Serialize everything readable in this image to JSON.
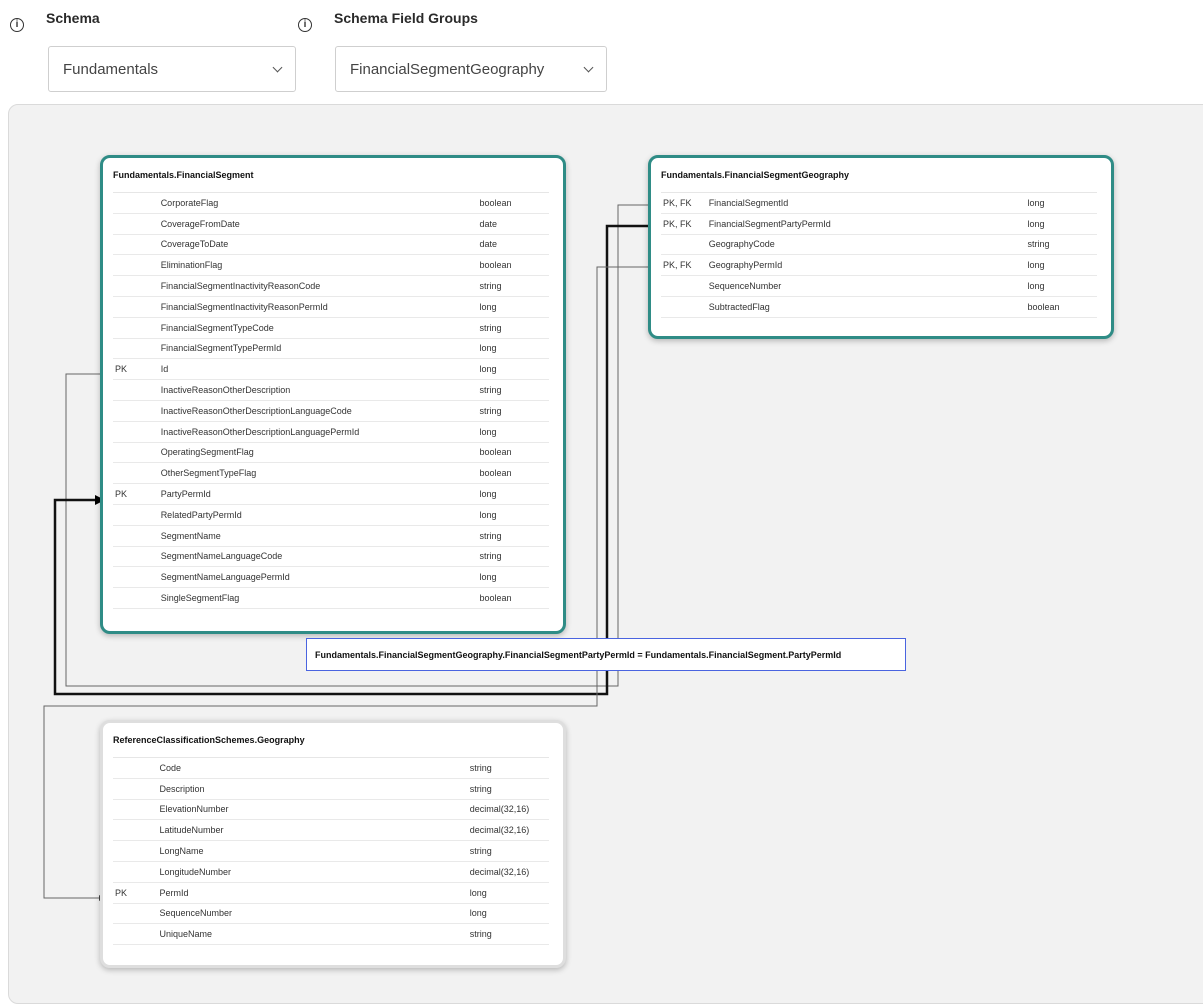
{
  "schema": {
    "label": "Schema",
    "value": "Fundamentals"
  },
  "field_groups": {
    "label": "Schema Field Groups",
    "value": "FinancialSegmentGeography"
  },
  "tables": [
    {
      "title": "Fundamentals.FinancialSegment",
      "rows": [
        {
          "key": "",
          "name": "CorporateFlag",
          "type": "boolean"
        },
        {
          "key": "",
          "name": "CoverageFromDate",
          "type": "date"
        },
        {
          "key": "",
          "name": "CoverageToDate",
          "type": "date"
        },
        {
          "key": "",
          "name": "EliminationFlag",
          "type": "boolean"
        },
        {
          "key": "",
          "name": "FinancialSegmentInactivityReasonCode",
          "type": "string"
        },
        {
          "key": "",
          "name": "FinancialSegmentInactivityReasonPermId",
          "type": "long"
        },
        {
          "key": "",
          "name": "FinancialSegmentTypeCode",
          "type": "string"
        },
        {
          "key": "",
          "name": "FinancialSegmentTypePermId",
          "type": "long"
        },
        {
          "key": "PK",
          "name": "Id",
          "type": "long"
        },
        {
          "key": "",
          "name": "InactiveReasonOtherDescription",
          "type": "string"
        },
        {
          "key": "",
          "name": "InactiveReasonOtherDescriptionLanguageCode",
          "type": "string"
        },
        {
          "key": "",
          "name": "InactiveReasonOtherDescriptionLanguagePermId",
          "type": "long"
        },
        {
          "key": "",
          "name": "OperatingSegmentFlag",
          "type": "boolean"
        },
        {
          "key": "",
          "name": "OtherSegmentTypeFlag",
          "type": "boolean"
        },
        {
          "key": "PK",
          "name": "PartyPermId",
          "type": "long"
        },
        {
          "key": "",
          "name": "RelatedPartyPermId",
          "type": "long"
        },
        {
          "key": "",
          "name": "SegmentName",
          "type": "string"
        },
        {
          "key": "",
          "name": "SegmentNameLanguageCode",
          "type": "string"
        },
        {
          "key": "",
          "name": "SegmentNameLanguagePermId",
          "type": "long"
        },
        {
          "key": "",
          "name": "SingleSegmentFlag",
          "type": "boolean"
        }
      ]
    },
    {
      "title": "Fundamentals.FinancialSegmentGeography",
      "rows": [
        {
          "key": "PK, FK",
          "name": "FinancialSegmentId",
          "type": "long"
        },
        {
          "key": "PK, FK",
          "name": "FinancialSegmentPartyPermId",
          "type": "long"
        },
        {
          "key": "",
          "name": "GeographyCode",
          "type": "string"
        },
        {
          "key": "PK, FK",
          "name": "GeographyPermId",
          "type": "long"
        },
        {
          "key": "",
          "name": "SequenceNumber",
          "type": "long"
        },
        {
          "key": "",
          "name": "SubtractedFlag",
          "type": "boolean"
        }
      ]
    },
    {
      "title": "ReferenceClassificationSchemes.Geography",
      "rows": [
        {
          "key": "",
          "name": "Code",
          "type": "string"
        },
        {
          "key": "",
          "name": "Description",
          "type": "string"
        },
        {
          "key": "",
          "name": "ElevationNumber",
          "type": "decimal(32,16)"
        },
        {
          "key": "",
          "name": "LatitudeNumber",
          "type": "decimal(32,16)"
        },
        {
          "key": "",
          "name": "LongName",
          "type": "string"
        },
        {
          "key": "",
          "name": "LongitudeNumber",
          "type": "decimal(32,16)"
        },
        {
          "key": "PK",
          "name": "PermId",
          "type": "long"
        },
        {
          "key": "",
          "name": "SequenceNumber",
          "type": "long"
        },
        {
          "key": "",
          "name": "UniqueName",
          "type": "string"
        }
      ]
    }
  ],
  "join_label": "Fundamentals.FinancialSegmentGeography.FinancialSegmentPartyPermId = Fundamentals.FinancialSegment.PartyPermId",
  "colors": {
    "accent": "#2f8c86",
    "join_border": "#4a64e0"
  },
  "icons": {
    "info": "info-circle-icon",
    "dropdown": "chevron-down-icon"
  }
}
